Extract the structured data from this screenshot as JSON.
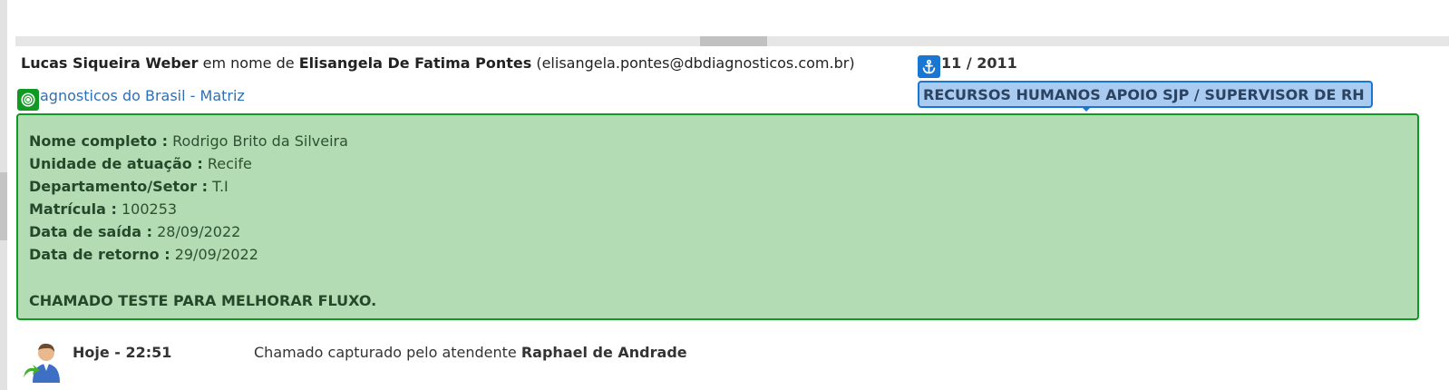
{
  "requester": {
    "name": "Lucas Siqueira Weber",
    "on_behalf_label": "em nome de",
    "beneficiary": "Elisangela De Fatima Pontes",
    "email": "(elisangela.pontes@dbdiagnosticos.com.br)"
  },
  "company": {
    "label": "agnosticos do Brasil - Matriz"
  },
  "ticket": {
    "date": "11 / 2011",
    "department": "RECURSOS HUMANOS APOIO SJP / SUPERVISOR DE RH"
  },
  "details": {
    "full_name": {
      "label": "Nome completo :",
      "value": "Rodrigo Brito da Silveira"
    },
    "unit": {
      "label": "Unidade de atuação :",
      "value": "Recife"
    },
    "department": {
      "label": "Departamento/Setor :",
      "value": "T.I"
    },
    "registration": {
      "label": "Matrícula :",
      "value": "100253"
    },
    "departure": {
      "label": "Data de saída :",
      "value": "28/09/2022"
    },
    "return": {
      "label": "Data de retorno :",
      "value": "29/09/2022"
    },
    "description": "CHAMADO TESTE PARA MELHORAR FLUXO."
  },
  "event": {
    "time": "Hoje - 22:51",
    "text": "Chamado capturado pelo atendente",
    "agent": "Raphael de Andrade"
  },
  "icons": {
    "anchor": "anchor-icon",
    "target": "target-icon",
    "user": "user-transfer-icon"
  },
  "colors": {
    "green_border": "#119a23",
    "green_bg": "#b3dcb5",
    "blue_border": "#1976d2",
    "blue_bg": "#a9cbf1",
    "link": "#2f6fb3"
  }
}
